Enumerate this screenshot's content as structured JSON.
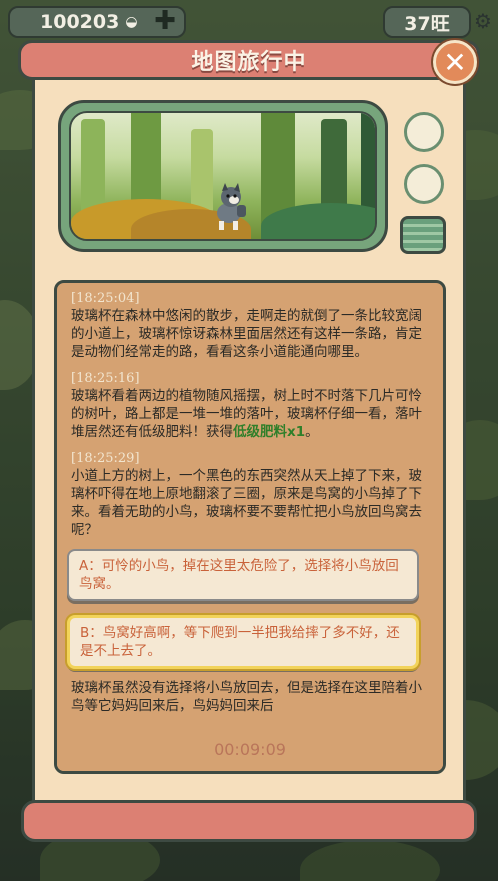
{
  "hud": {
    "coins": "100203",
    "plus_icon": "plus-icon",
    "wang_count": "37旺",
    "settings_icon": "gear-icon"
  },
  "dialog": {
    "title": "地图旅行中",
    "close_icon": "close-icon"
  },
  "log": {
    "entries": [
      {
        "time": "[18:25:04]",
        "text": " 玻璃杯在森林中悠闲的散步，走啊走的就倒了一条比较宽阔的小道上，玻璃杯惊讶森林里面居然还有这样一条路，肯定是动物们经常走的路，看看这条小道能通向哪里。"
      },
      {
        "time": "[18:25:16]",
        "text": " 玻璃杯看着两边的植物随风摇摆，树上时不时落下几片可怜的树叶，路上都是一堆一堆的落叶，玻璃杯仔细一看，落叶堆居然还有低级肥料！获得",
        "highlight": "低级肥料x1",
        "suffix": "。"
      },
      {
        "time": "[18:25:29]",
        "text": " 小道上方的树上，一个黑色的东西突然从天上掉了下来，玻璃杯吓得在地上原地翻滚了三圈，原来是鸟窝的小鸟掉了下来。看着无助的小鸟，玻璃杯要不要帮忙把小鸟放回鸟窝去呢？"
      }
    ],
    "choice_a": "A：可怜的小鸟，掉在这里太危险了，选择将小鸟放回鸟窝。",
    "choice_b": "B：鸟窝好高啊，等下爬到一半把我给摔了多不好，还是不上去了。",
    "trailing_text": "玻璃杯虽然没有选择将小鸟放回去，但是选择在这里陪着小鸟等它妈妈回来后，鸟妈妈回来后",
    "timer": "00:09:09"
  },
  "colors": {
    "title_bar": "#dc8073",
    "panel": "#f6dfbd",
    "log_bg": "#d5a272",
    "highlight": "#2f7f2a",
    "choice_text": "#c9623a",
    "selected_border": "#f2d35a"
  }
}
